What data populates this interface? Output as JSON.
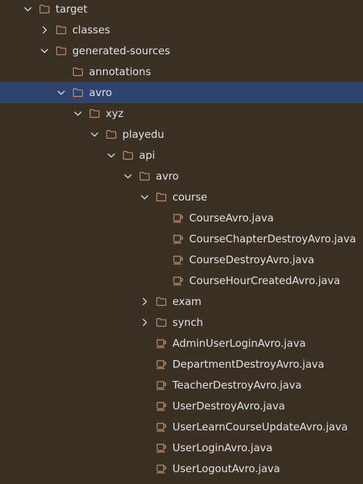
{
  "project_tree": {
    "colors": {
      "background": "#3a3023",
      "selection": "#2e436e",
      "text": "#dfe1e5",
      "icon": "#c69276"
    },
    "items": [
      {
        "label": "target",
        "depth": 0,
        "expander": "expanded",
        "icon": "folder-icon",
        "selected": false
      },
      {
        "label": "classes",
        "depth": 1,
        "expander": "collapsed",
        "icon": "folder-icon",
        "selected": false
      },
      {
        "label": "generated-sources",
        "depth": 1,
        "expander": "expanded",
        "icon": "folder-icon",
        "selected": false
      },
      {
        "label": "annotations",
        "depth": 2,
        "expander": "none",
        "icon": "folder-icon",
        "selected": false
      },
      {
        "label": "avro",
        "depth": 2,
        "expander": "expanded",
        "icon": "folder-icon",
        "selected": true
      },
      {
        "label": "xyz",
        "depth": 3,
        "expander": "expanded",
        "icon": "folder-icon",
        "selected": false
      },
      {
        "label": "playedu",
        "depth": 4,
        "expander": "expanded",
        "icon": "folder-icon",
        "selected": false
      },
      {
        "label": "api",
        "depth": 5,
        "expander": "expanded",
        "icon": "folder-icon",
        "selected": false
      },
      {
        "label": "avro",
        "depth": 6,
        "expander": "expanded",
        "icon": "folder-icon",
        "selected": false
      },
      {
        "label": "course",
        "depth": 7,
        "expander": "expanded",
        "icon": "folder-icon",
        "selected": false
      },
      {
        "label": "CourseAvro.java",
        "depth": 8,
        "expander": "none",
        "icon": "java-cup-icon",
        "selected": false
      },
      {
        "label": "CourseChapterDestroyAvro.java",
        "depth": 8,
        "expander": "none",
        "icon": "java-cup-icon",
        "selected": false
      },
      {
        "label": "CourseDestroyAvro.java",
        "depth": 8,
        "expander": "none",
        "icon": "java-cup-icon",
        "selected": false
      },
      {
        "label": "CourseHourCreatedAvro.java",
        "depth": 8,
        "expander": "none",
        "icon": "java-cup-icon",
        "selected": false
      },
      {
        "label": "exam",
        "depth": 7,
        "expander": "collapsed",
        "icon": "folder-icon",
        "selected": false
      },
      {
        "label": "synch",
        "depth": 7,
        "expander": "collapsed",
        "icon": "folder-icon",
        "selected": false
      },
      {
        "label": "AdminUserLoginAvro.java",
        "depth": 7,
        "expander": "none",
        "icon": "java-cup-icon",
        "selected": false
      },
      {
        "label": "DepartmentDestroyAvro.java",
        "depth": 7,
        "expander": "none",
        "icon": "java-cup-icon",
        "selected": false
      },
      {
        "label": "TeacherDestroyAvro.java",
        "depth": 7,
        "expander": "none",
        "icon": "java-cup-icon",
        "selected": false
      },
      {
        "label": "UserDestroyAvro.java",
        "depth": 7,
        "expander": "none",
        "icon": "java-cup-icon",
        "selected": false
      },
      {
        "label": "UserLearnCourseUpdateAvro.java",
        "depth": 7,
        "expander": "none",
        "icon": "java-cup-icon",
        "selected": false
      },
      {
        "label": "UserLoginAvro.java",
        "depth": 7,
        "expander": "none",
        "icon": "java-cup-icon",
        "selected": false
      },
      {
        "label": "UserLogoutAvro.java",
        "depth": 7,
        "expander": "none",
        "icon": "java-cup-icon",
        "selected": false
      }
    ]
  }
}
